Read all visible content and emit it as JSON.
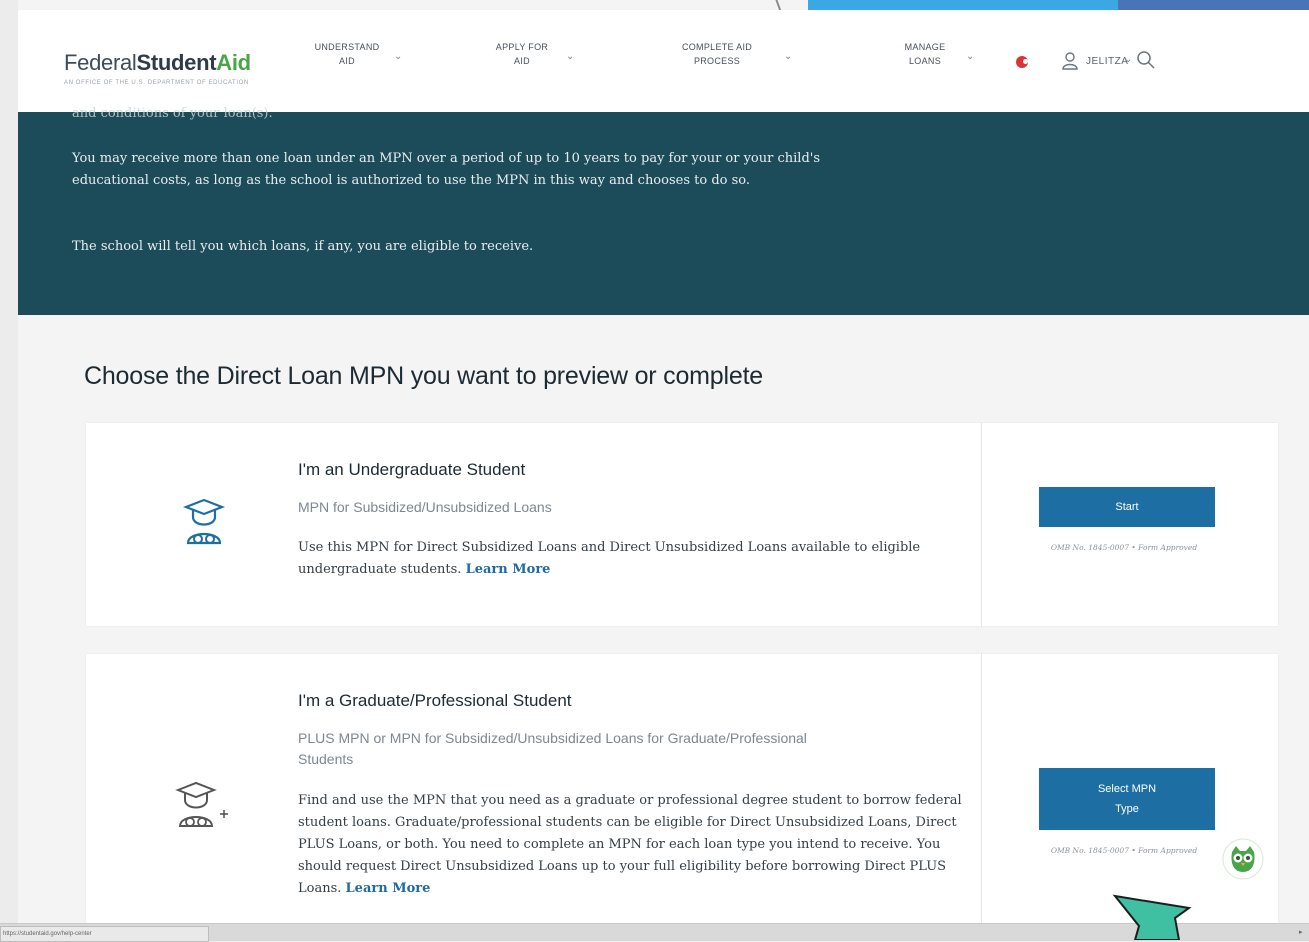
{
  "header": {
    "logo_text_a": "Federal",
    "logo_text_b": "Student",
    "logo_text_c": "Aid",
    "logo_subtitle": "AN OFFICE OF THE U.S. DEPARTMENT OF EDUCATION",
    "nav": [
      {
        "line1": "UNDERSTAND",
        "line2": "AID"
      },
      {
        "line1": "APPLY FOR",
        "line2": "AID"
      },
      {
        "line1": "COMPLETE AID",
        "line2": "PROCESS"
      },
      {
        "line1": "MANAGE",
        "line2": "LOANS"
      }
    ],
    "user_name": "JELITZA"
  },
  "banner": {
    "cut_line": "and conditions of your loan(s).",
    "para1": "You may receive more than one loan under an MPN over a period of up to 10 years to pay for your or your child's educational costs, as long as the school is authorized to use the MPN in this way and chooses to do so.",
    "para2": "The school will tell you which loans, if any, you are eligible to receive."
  },
  "main": {
    "heading": "Choose the Direct Loan MPN you want to preview or complete",
    "cards": [
      {
        "title": "I'm an Undergraduate Student",
        "subtitle": "MPN for Subsidized/Unsubsidized Loans",
        "description": "Use this MPN for Direct Subsidized Loans and Direct Unsubsidized Loans available to eligible undergraduate students.",
        "learn_more": "Learn More",
        "button": "Start",
        "omb": "OMB No. 1845-0007 • Form Approved"
      },
      {
        "title": "I'm a Graduate/Professional Student",
        "subtitle": "PLUS MPN or MPN for Subsidized/Unsubsidized Loans for Graduate/Professional Students",
        "description": "Find and use the MPN that you need as a graduate or professional degree student to borrow federal student loans. Graduate/professional students can be eligible for Direct Unsubsidized Loans, Direct PLUS Loans, or both. You need to complete an MPN for each loan type you intend to receive. You should request Direct Unsubsidized Loans up to your full eligibility before borrowing Direct PLUS Loans.",
        "learn_more": "Learn More",
        "button_line1": "Select MPN",
        "button_line2": "Type",
        "omb": "OMB No. 1845-0007 • Form Approved"
      }
    ]
  },
  "status": {
    "url": "https://studentaid.gov/help-center"
  },
  "colors": {
    "banner": "#1c4b5a",
    "button": "#1d6fa3",
    "aid_green": "#4aa54a",
    "arrow": "#3fc0a3"
  }
}
